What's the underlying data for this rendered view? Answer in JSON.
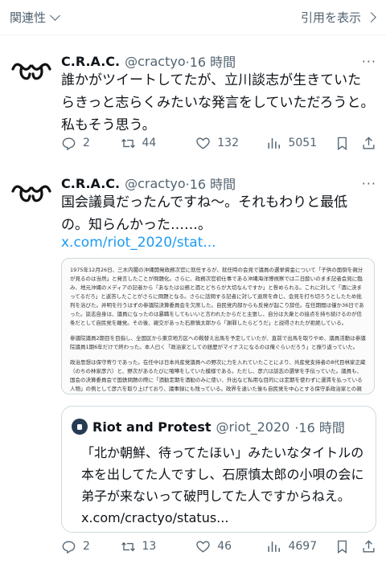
{
  "topbar": {
    "sort_label": "関連性",
    "quote_link_label": "引用を表示"
  },
  "tweets": [
    {
      "name": "C.R.A.C.",
      "handle": "@cractyo",
      "time": "·16 時間",
      "text": "誰かがツイートしてたが、立川談志が生きていたらきっと志らくみたいな発言をしていただろうと。私もそう思う。",
      "replies": "2",
      "retweets": "44",
      "likes": "132",
      "views": "5051"
    },
    {
      "name": "C.R.A.C.",
      "handle": "@cractyo",
      "time": "·16 時間",
      "text": "国会議員だったんですね〜。それもわりと最低の。知らんかった……。",
      "link": "x.com/riot_2020/stat...",
      "attached_paragraphs": [
        "1975年12月26日、三木内閣の沖縄開発政務次官に就任するが、就任時の会見で議員の選挙資金について「子供の面倒を親分が見るのは当然」と発言したことが問題化。さらに、政務次官初仕事である沖縄海洋博視察では二日酔いのまま記者会見に臨み、地元沖縄のメディアの記者から「あなたは公務と酒とどちらが大切なんですか」と咎められる。これに対して「酒に決まってるだろ」と返答したことがさらに問題となる。さらに話問する記者に対して退席を命じ、会見を打ち切ろうとしたため批判を浴びた。并明を行うはずの参議院決算委員会を欠席した。自民党内部からも反発が起こり辞任。在任期間は僅か36日であった。談志自身は、議員になったのは暴職をしてもいいと言われたからだと主張し、自分は大衆との接点を持ち続けるのが信条だとして自民党を離党。その後、親交があった石原慎太郎から「謝罪したらどうだ」と説得されたが拒絶している。",
        "参議院議員2期目を目指し、全国区から東京地方区への鞍替え出馬を予定していたが、直前で出馬を取りやめ、議員活動は参議院議員1期6年だけで終わった。本人曰く「政治家としての経歴がマイナスになるのは俺ぐらいだろう」と振り返っていた。",
        "政治思想は保守寄りであった。在任中は日本共産党議員への野次に力を入れていたことにより、共産党支持者の8代目林家正蔵（のちの林家彦六）と、野次があるたびに喧嘩をしていた模様である。ただし、彦六は談志の選挙を手伝っていた。議員も、国会の決算委員会で国鉄問題の際に「酒勧定期を酒勧のみに使い、外出など私用な目的には定期を使わずに運賃を払っている人物」の例として彦六を取り上げており、議事録にも残っている。政界を退いた後も自民党を中心とする保守系政治家との親交を深め、保守系議員の選挙応援などにもしばしば動いた。"
      ],
      "quote": {
        "name": "Riot and Protest",
        "handle": "@riot_2020",
        "time": "·16 時間",
        "text": "「北か朝鮮、待ってたほい」みたいなタイトルの本を出してた人ですし、石原慎太郎の小唄の会に弟子が来ないって破門してた人ですからねえ。",
        "link": "x.com/cractyo/status..."
      },
      "replies": "2",
      "retweets": "13",
      "likes": "46",
      "views": "4697"
    }
  ],
  "colors": {
    "text": "#0f1419",
    "secondary": "#536471",
    "link": "#1d9bf0",
    "border": "#cfd9de"
  }
}
